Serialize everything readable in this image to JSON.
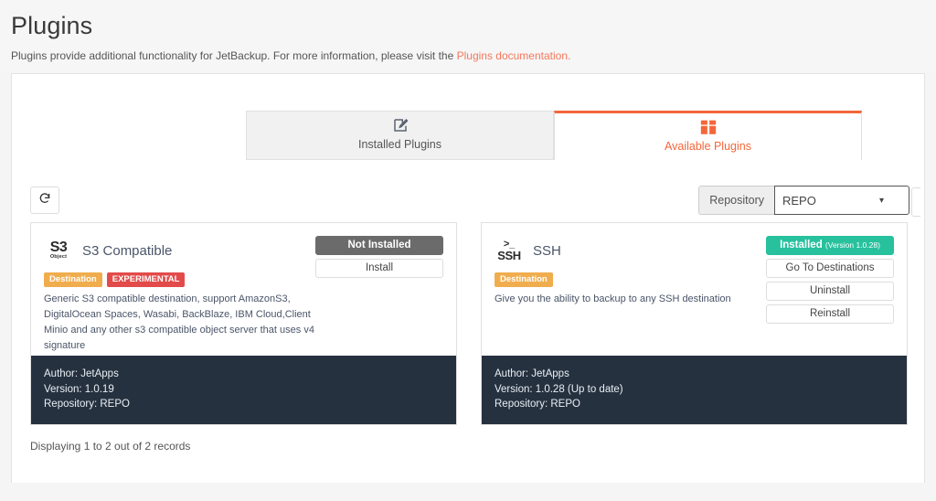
{
  "header": {
    "title": "Plugins",
    "subtitle_prefix": "Plugins provide additional functionality for JetBackup. For more information, please visit the ",
    "doc_link_text": "Plugins documentation."
  },
  "tabs": [
    {
      "label": "Installed Plugins",
      "icon": "edit-square-icon",
      "active": false
    },
    {
      "label": "Available Plugins",
      "icon": "box-icon",
      "active": true
    }
  ],
  "toolbar": {
    "refresh_icon": "refresh-icon",
    "repository_label": "Repository",
    "repository_value": "REPO",
    "repository_options": [
      "REPO"
    ],
    "caret_icon": "chevron-down-icon"
  },
  "cards": [
    {
      "logo_main": "S3",
      "logo_sub": "Object",
      "name": "S3 Compatible",
      "badges": [
        {
          "text": "Destination",
          "type": "destination"
        },
        {
          "text": "EXPERIMENTAL",
          "type": "experimental"
        }
      ],
      "description": "Generic S3 compatible destination, support AmazonS3, DigitalOcean Spaces, Wasabi, BackBlaze, IBM Cloud,Client Minio and any other s3 compatible object server that uses v4 signature",
      "status_label": "Not Installed",
      "status_version": "",
      "status_style": "grey",
      "buttons": [
        "Install"
      ],
      "footer": {
        "author": "Author: JetApps",
        "version": "Version: 1.0.19",
        "repository": "Repository: REPO"
      }
    },
    {
      "logo_main": ">_",
      "logo_sub": "SSH",
      "name": "SSH",
      "badges": [
        {
          "text": "Destination",
          "type": "destination"
        }
      ],
      "description": "Give you the ability to backup to any SSH destination",
      "status_label": "Installed",
      "status_version": "(Version 1.0.28)",
      "status_style": "green",
      "buttons": [
        "Go To Destinations",
        "Uninstall",
        "Reinstall"
      ],
      "footer": {
        "author": "Author: JetApps",
        "version": "Version: 1.0.28 (Up to date)",
        "repository": "Repository: REPO"
      }
    }
  ],
  "footer": {
    "records_text": "Displaying 1 to 2 out of 2 records"
  },
  "colors": {
    "accent": "#f4663a",
    "link": "#f4775c",
    "badge_destination": "#f0ad4e",
    "badge_experimental": "#e34b4b",
    "status_installed": "#27c19d",
    "status_not_installed": "#6b6b6b",
    "footer_dark": "#26313f"
  }
}
